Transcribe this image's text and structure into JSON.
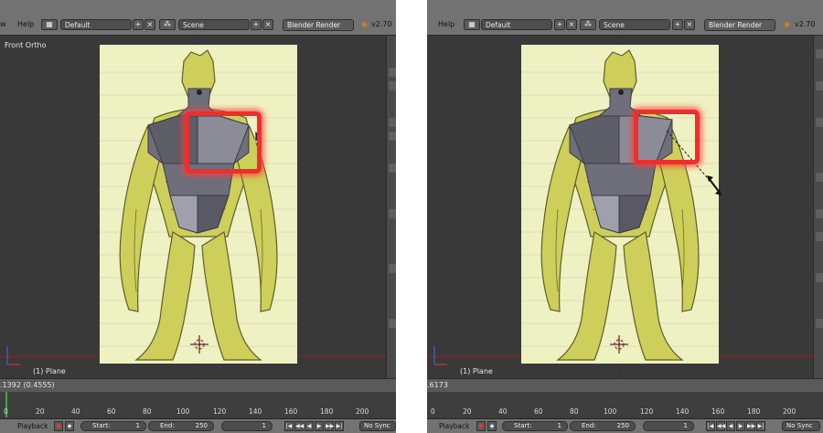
{
  "menu": {
    "help": "Help",
    "left_fragment": "w"
  },
  "layout_field": "Default",
  "scene_field": "Scene",
  "render_engine": "Blender Render",
  "version_left": "v2.70",
  "version_right": "v2.70",
  "viewport": {
    "view_name": "Front Ortho",
    "object_name": "(1) Plane"
  },
  "status_left": ".1392 (0.4555)",
  "status_right": ".6173",
  "timeline": {
    "ticks": [
      "0",
      "20",
      "40",
      "60",
      "80",
      "100",
      "120",
      "140",
      "160",
      "180",
      "200"
    ]
  },
  "footer": {
    "playback": "Playback",
    "start_label": "Start:",
    "start_value": "1",
    "end_label": "End:",
    "end_value": "250",
    "current_frame": "1",
    "sync": "No Sync"
  },
  "colors": {
    "highlight": "#ef2d2d",
    "reference": "#eef1c1",
    "mesh": "#6e6f7a",
    "creature": "#cdcf5a"
  },
  "icons": [
    "layout-icon",
    "scene-icon",
    "blender-logo-icon",
    "add-icon",
    "close-icon",
    "record-icon",
    "keyframe-icon",
    "play-icon",
    "jump-end-icon",
    "jump-start-icon",
    "cursor-arrow-icon",
    "resize-cursor-icon",
    "3d-cursor-icon"
  ]
}
